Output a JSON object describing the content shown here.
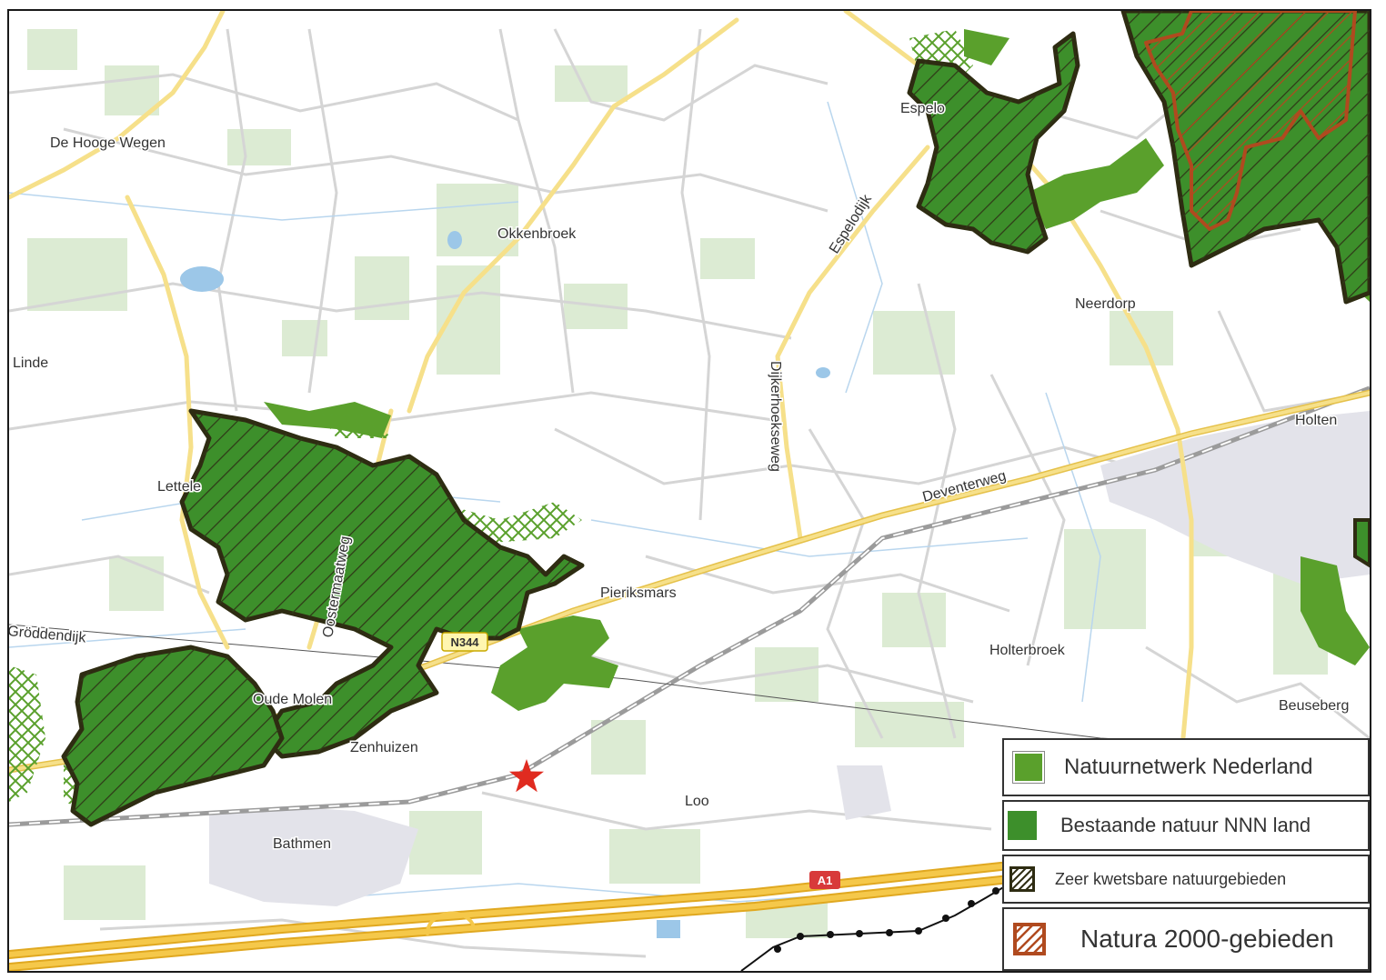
{
  "colors": {
    "nnn": "#5aa02c",
    "nnn_existing": "#3d8f2b",
    "vulnerable_outline": "#3b3a1a",
    "natura2000": "#b04a1f",
    "motorway": "#f2c040",
    "secondary_road": "#f6e08a",
    "water": "#9cc7e8",
    "rail": "#aaaaaa",
    "marker": "#e02b20"
  },
  "places": {
    "de_hooge_wegen": "De Hooge Wegen",
    "okkenbroek": "Okkenbroek",
    "linde": "Linde",
    "lettele": "Lettele",
    "neerdorp": "Neerdorp",
    "holten": "Holten",
    "pierikmars": "Pieriksmars",
    "holterbroek": "Holterbroek",
    "beuseberg": "Beuseberg",
    "oude_molen": "Oude Molen",
    "espelo": "Espelo",
    "loo": "Loo",
    "bathmen": "Bathmen",
    "zenhuizen": "Zenhuizen"
  },
  "roads": {
    "espelodijk": "Espelodijk",
    "dijkerhoekseweg": "Dijkerhoekseweg",
    "deventerweg": "Deventerweg",
    "oostermaatweg": "Oostermaatweg",
    "groddendijk": "Gröddendijk",
    "n344": "N344",
    "a1": "A1"
  },
  "marker": {
    "icon": "star-icon"
  },
  "legend": {
    "items": [
      {
        "label": "Natuurnetwerk Nederland",
        "swatch": "solid-green"
      },
      {
        "label": "Bestaande natuur NNN land",
        "swatch": "solid-dark-green"
      },
      {
        "label": "Zeer kwetsbare natuurgebieden",
        "swatch": "hatched-dark"
      },
      {
        "label": "Natura 2000-gebieden",
        "swatch": "hatched-brown"
      }
    ]
  }
}
